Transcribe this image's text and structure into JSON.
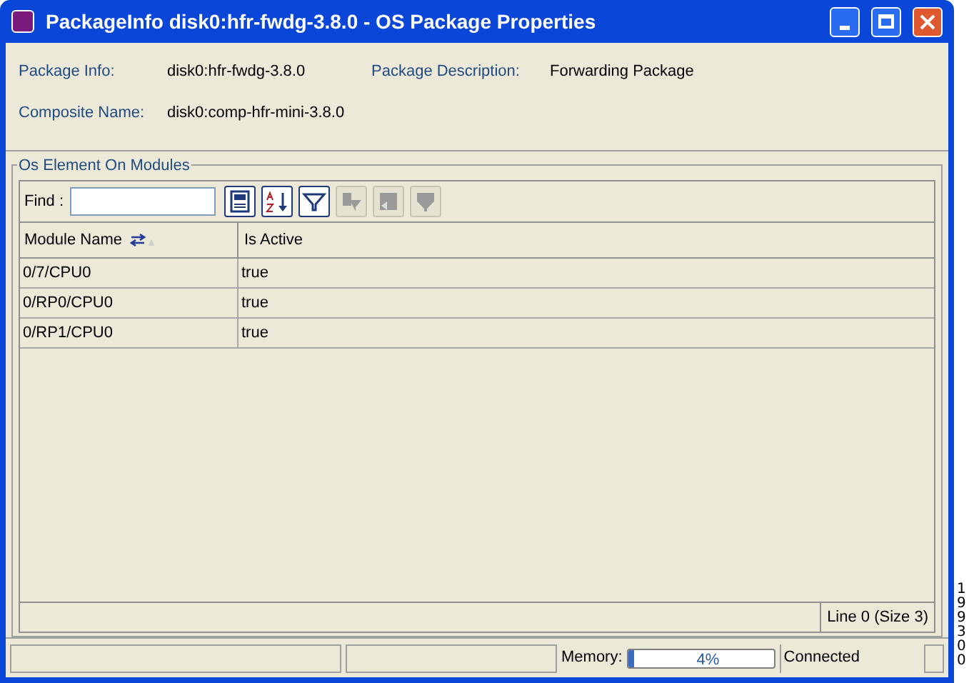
{
  "window": {
    "title": "PackageInfo disk0:hfr-fwdg-3.8.0 - OS Package Properties"
  },
  "properties": [
    {
      "label": "Package Info:",
      "value": "disk0:hfr-fwdg-3.8.0"
    },
    {
      "label": "Package Description:",
      "value": "Forwarding Package"
    },
    {
      "label": "Composite Name:",
      "value": "disk0:comp-hfr-mini-3.8.0"
    }
  ],
  "group": {
    "title": "Os Element On Modules"
  },
  "find": {
    "label": "Find :"
  },
  "toolbar": [
    {
      "kind": "save",
      "disabled": false
    },
    {
      "kind": "sort",
      "disabled": false
    },
    {
      "kind": "filter",
      "disabled": false
    },
    {
      "kind": "clear-filter",
      "disabled": true
    },
    {
      "kind": "back",
      "disabled": true
    },
    {
      "kind": "filter-down",
      "disabled": true
    }
  ],
  "table": {
    "columns": [
      "Module Name",
      "Is Active"
    ],
    "rows": [
      [
        "0/7/CPU0",
        "true"
      ],
      [
        "0/RP0/CPU0",
        "true"
      ],
      [
        "0/RP1/CPU0",
        "true"
      ]
    ],
    "footer": "Line 0 (Size 3)"
  },
  "status_bar": {
    "memory_label": "Memory:",
    "memory": {
      "level": 0.04,
      "reading": "4%"
    },
    "connection": "Connected"
  },
  "figure_id": "199300"
}
